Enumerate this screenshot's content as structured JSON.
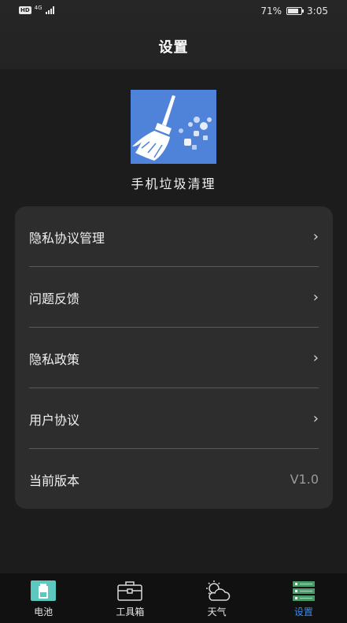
{
  "status_bar": {
    "hd": "HD",
    "network": "4G",
    "battery_percent": "71%",
    "time": "3:05",
    "battery_level": 0.71
  },
  "header": {
    "title": "设置"
  },
  "app": {
    "name": "手机垃圾清理",
    "logo_icon": "broom-icon",
    "logo_color": "#4f83d9"
  },
  "settings": {
    "items": [
      {
        "label": "隐私协议管理",
        "icon": "chevron-right-icon"
      },
      {
        "label": "问题反馈",
        "icon": "chevron-right-icon"
      },
      {
        "label": "隐私政策",
        "icon": "chevron-right-icon"
      },
      {
        "label": "用户协议",
        "icon": "chevron-right-icon"
      },
      {
        "label": "当前版本",
        "value": "V1.0"
      }
    ]
  },
  "bottom_nav": {
    "items": [
      {
        "label": "电池",
        "icon": "battery-icon"
      },
      {
        "label": "工具箱",
        "icon": "toolbox-icon"
      },
      {
        "label": "天气",
        "icon": "weather-icon"
      },
      {
        "label": "设置",
        "icon": "settings-server-icon",
        "active": true
      }
    ],
    "active_color": "#3e8ae5"
  }
}
